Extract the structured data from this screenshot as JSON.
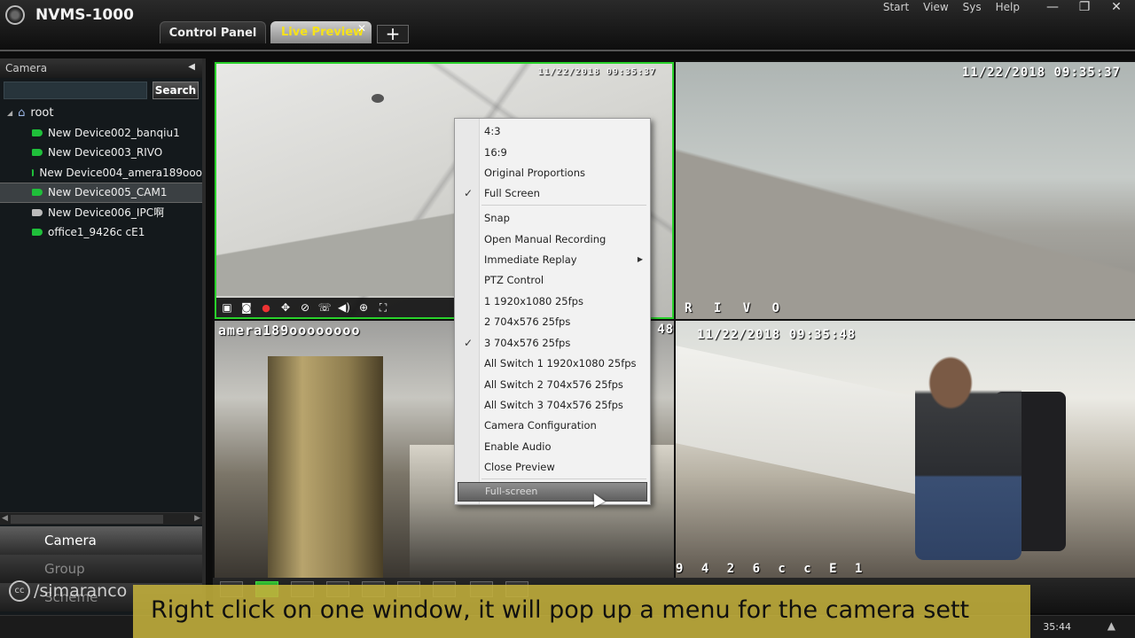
{
  "app": {
    "title": "NVMS-1000"
  },
  "top_menu": [
    "Start",
    "View",
    "Sys",
    "Help"
  ],
  "window_controls": [
    "—",
    "❐",
    "✕"
  ],
  "tabs": [
    {
      "label": "Control Panel",
      "active": false
    },
    {
      "label": "Live Preview",
      "active": true
    }
  ],
  "tab_close": "✕",
  "tab_add": "+",
  "sidebar": {
    "header": "Camera",
    "collapse_glyph": "◀",
    "search_button": "Search",
    "search_value": "",
    "tree": {
      "root": "root",
      "devices": [
        {
          "label": "New Device002_banqiu1",
          "status": "online",
          "selected": false
        },
        {
          "label": "New Device003_RIVO",
          "status": "online",
          "selected": false
        },
        {
          "label": "New Device004_amera189ooo",
          "status": "online",
          "selected": false
        },
        {
          "label": "New Device005_CAM1",
          "status": "online",
          "selected": true
        },
        {
          "label": "New  Device006_IPC啊",
          "status": "offline",
          "selected": false
        },
        {
          "label": "office1_9426c cE1",
          "status": "online",
          "selected": false
        }
      ]
    },
    "panels": [
      {
        "label": "Camera",
        "active": true
      },
      {
        "label": "Group",
        "active": false
      },
      {
        "label": "Scheme",
        "active": false
      }
    ]
  },
  "tiles": [
    {
      "timestamp": "11/22/2018 09:35:37",
      "name": ""
    },
    {
      "timestamp": "11/22/2018 09:35:37",
      "name": "R I V O"
    },
    {
      "timestamp": "48",
      "name": "amera189oooooooo"
    },
    {
      "timestamp": "11/22/2018 09:35:48",
      "name": "9 4 2 6 c  c E 1"
    }
  ],
  "tile_toolbar_icons": [
    "snapshot-icon",
    "camera-icon",
    "record-icon",
    "ptz-icon",
    "zoom-ring-icon",
    "talk-icon",
    "audio-icon",
    "zoom-in-icon",
    "fullscreen-icon"
  ],
  "context_menu": {
    "items": [
      {
        "label": "4:3",
        "checked": false
      },
      {
        "label": "16:9",
        "checked": false
      },
      {
        "label": "Original Proportions",
        "checked": false
      },
      {
        "label": "Full Screen",
        "checked": true
      },
      {
        "label": "Snap",
        "checked": false
      },
      {
        "label": "Open Manual Recording",
        "checked": false
      },
      {
        "label": "Immediate Replay",
        "checked": false,
        "submenu": true
      },
      {
        "label": "PTZ Control",
        "checked": false
      },
      {
        "label": "1 1920x1080 25fps",
        "checked": false
      },
      {
        "label": "2 704x576 25fps",
        "checked": false
      },
      {
        "label": "3 704x576 25fps",
        "checked": true
      },
      {
        "label": "All Switch 1 1920x1080 25fps",
        "checked": false
      },
      {
        "label": "All Switch 2 704x576 25fps",
        "checked": false
      },
      {
        "label": "All Switch 3 704x576 25fps",
        "checked": false
      },
      {
        "label": "Camera Configuration",
        "checked": false
      },
      {
        "label": "Enable Audio",
        "checked": false
      },
      {
        "label": "Close Preview",
        "checked": false
      }
    ],
    "highlighted": "Full-screen",
    "check_glyph": "✓",
    "submenu_glyph": "▶"
  },
  "statusbar": {
    "time": "35:44",
    "up_glyph": "▲"
  },
  "watermark": {
    "icon": "cc",
    "text": "/simaranco"
  },
  "caption": "Right click on one window, it will pop up a menu for the camera sett"
}
